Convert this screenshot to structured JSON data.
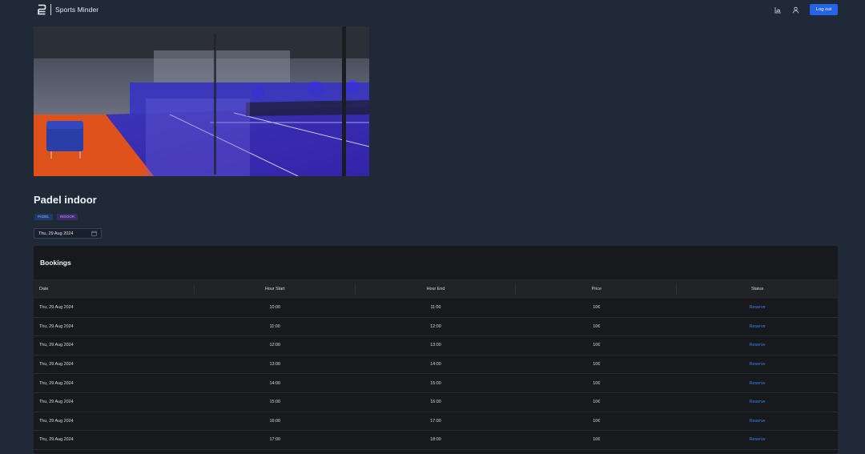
{
  "header": {
    "app_name": "Sports Minder",
    "logout_label": "Log out",
    "icons": [
      "stats-icon",
      "user-icon"
    ]
  },
  "facility": {
    "title": "Padel indoor",
    "tags": [
      "PADEL",
      "INDOOR"
    ],
    "selected_date": "Thu, 29 Aug 2024"
  },
  "bookings": {
    "title": "Bookings",
    "columns": [
      "Date",
      "Hour Start",
      "Hour End",
      "Price",
      "Status"
    ],
    "rows": [
      {
        "date": "Thu, 29 Aug 2024",
        "start": "10:00",
        "end": "11:00",
        "price": "10€",
        "status": "Reserve"
      },
      {
        "date": "Thu, 29 Aug 2024",
        "start": "11:00",
        "end": "12:00",
        "price": "10€",
        "status": "Reserve"
      },
      {
        "date": "Thu, 29 Aug 2024",
        "start": "12:00",
        "end": "13:00",
        "price": "10€",
        "status": "Reserve"
      },
      {
        "date": "Thu, 29 Aug 2024",
        "start": "13:00",
        "end": "14:00",
        "price": "10€",
        "status": "Reserve"
      },
      {
        "date": "Thu, 29 Aug 2024",
        "start": "14:00",
        "end": "15:00",
        "price": "10€",
        "status": "Reserve"
      },
      {
        "date": "Thu, 29 Aug 2024",
        "start": "15:00",
        "end": "16:00",
        "price": "10€",
        "status": "Reserve"
      },
      {
        "date": "Thu, 29 Aug 2024",
        "start": "16:00",
        "end": "17:00",
        "price": "10€",
        "status": "Reserve"
      },
      {
        "date": "Thu, 29 Aug 2024",
        "start": "17:00",
        "end": "18:00",
        "price": "10€",
        "status": "Reserve"
      }
    ]
  },
  "colors": {
    "background": "#202938",
    "accent": "#2563eb",
    "link": "#3b82f6",
    "card": "#18191c"
  }
}
